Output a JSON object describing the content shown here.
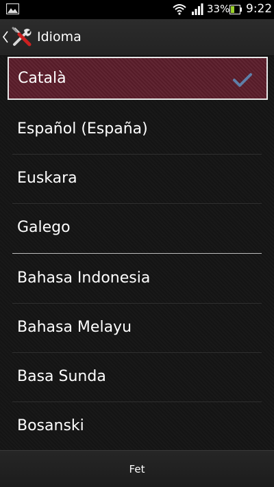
{
  "status_bar": {
    "battery_percent": "33%",
    "time": "9:22",
    "icons": [
      "gallery-notification-icon",
      "wifi-icon",
      "signal-icon",
      "battery-icon"
    ]
  },
  "action_bar": {
    "title": "Idioma",
    "icons": [
      "back-chevron-icon",
      "tools-icon"
    ]
  },
  "languages": [
    {
      "label": "Català",
      "selected": true
    },
    {
      "label": "Español (España)",
      "selected": false
    },
    {
      "label": "Euskara",
      "selected": false
    },
    {
      "label": "Galego",
      "selected": false
    },
    {
      "label": "Bahasa Indonesia",
      "selected": false
    },
    {
      "label": "Bahasa Melayu",
      "selected": false
    },
    {
      "label": "Basa Sunda",
      "selected": false
    },
    {
      "label": "Bosanski",
      "selected": false
    }
  ],
  "footer": {
    "done_label": "Fet"
  },
  "colors": {
    "selected_background": "#5b1d2b",
    "check_color": "#5e7fa8"
  }
}
